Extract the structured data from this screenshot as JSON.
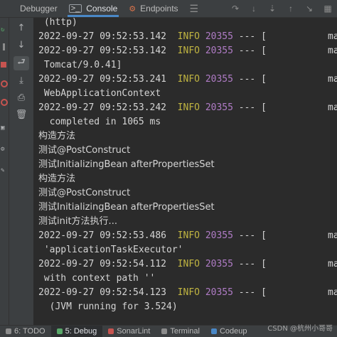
{
  "tabs": [
    {
      "label": "Debugger",
      "active": false
    },
    {
      "label": "Console",
      "active": true,
      "icon": "console-icon"
    },
    {
      "label": "Endpoints",
      "active": false,
      "icon": "endpoints-icon"
    }
  ],
  "console_lines": [
    {
      "text": " (http)"
    },
    {
      "date": "2022-09-27 09:52:53.142",
      "level": "INFO",
      "pid": "20355",
      "sep": "--- [",
      "thread": "mai"
    },
    {
      "date": "2022-09-27 09:52:53.142",
      "level": "INFO",
      "pid": "20355",
      "sep": "--- [",
      "thread": "mai"
    },
    {
      "text": " Tomcat/9.0.41]"
    },
    {
      "date": "2022-09-27 09:52:53.241",
      "level": "INFO",
      "pid": "20355",
      "sep": "--- [",
      "thread": "mai"
    },
    {
      "text": " WebApplicationContext"
    },
    {
      "date": "2022-09-27 09:52:53.242",
      "level": "INFO",
      "pid": "20355",
      "sep": "--- [",
      "thread": "mai"
    },
    {
      "text": "  completed in 1065 ms"
    },
    {
      "text": "构造方法",
      "cjk": true
    },
    {
      "text": "测试@PostConstruct",
      "cjk": true
    },
    {
      "text": "测试InitializingBean afterPropertiesSet",
      "cjk": true
    },
    {
      "text": "构造方法",
      "cjk": true
    },
    {
      "text": "测试@PostConstruct",
      "cjk": true
    },
    {
      "text": "测试InitializingBean afterPropertiesSet",
      "cjk": true
    },
    {
      "text": "测试init方法执行...",
      "cjk": true
    },
    {
      "date": "2022-09-27 09:52:53.486",
      "level": "INFO",
      "pid": "20355",
      "sep": "--- [",
      "thread": "mai"
    },
    {
      "text": " 'applicationTaskExecutor'"
    },
    {
      "date": "2022-09-27 09:52:54.112",
      "level": "INFO",
      "pid": "20355",
      "sep": "--- [",
      "thread": "mai"
    },
    {
      "text": " with context path ''"
    },
    {
      "date": "2022-09-27 09:52:54.123",
      "level": "INFO",
      "pid": "20355",
      "sep": "--- [",
      "thread": "mai"
    },
    {
      "text": "  (JVM running for 3.524)"
    }
  ],
  "bottom_tabs": [
    {
      "label": "6: TODO"
    },
    {
      "label": "5: Debug",
      "active": true
    },
    {
      "label": "SonarLint"
    },
    {
      "label": "Terminal"
    },
    {
      "label": "Codeup"
    }
  ],
  "watermark": "CSDN @杭州小哥哥",
  "colors": {
    "info": "#c0b441",
    "pid": "#b07cc6",
    "text": "#d5d5d5",
    "accent": "#4a88c7"
  }
}
